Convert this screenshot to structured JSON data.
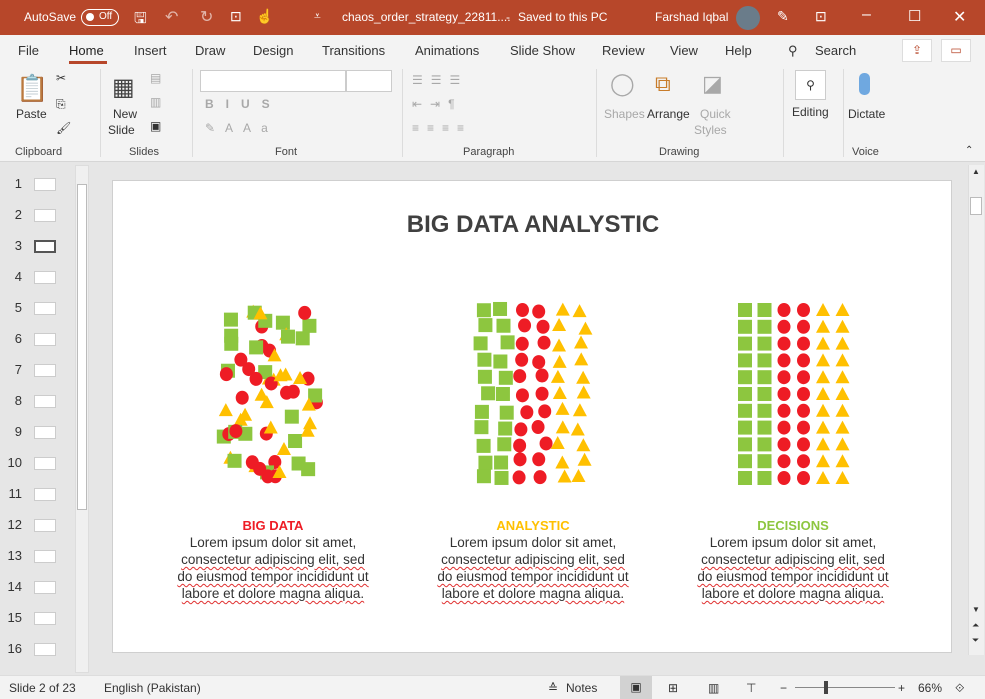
{
  "titlebar": {
    "autosave": "AutoSave",
    "autosave_state": "Off",
    "filename": "chaos_order_strategy_22811....",
    "separator": "-",
    "save_status": "Saved to this PC",
    "user": "Farshad Iqbal"
  },
  "menu": [
    "File",
    "Home",
    "Insert",
    "Draw",
    "Design",
    "Transitions",
    "Animations",
    "Slide Show",
    "Review",
    "View",
    "Help"
  ],
  "search": "Search",
  "ribbon": {
    "paste": "Paste",
    "new_slide_1": "New",
    "new_slide_2": "Slide",
    "shapes": "Shapes",
    "arrange": "Arrange",
    "quick_1": "Quick",
    "quick_2": "Styles",
    "editing": "Editing",
    "dictate": "Dictate",
    "groups": [
      "Clipboard",
      "Slides",
      "Font",
      "Paragraph",
      "Drawing",
      "Voice"
    ]
  },
  "thumbnails": [
    "1",
    "2",
    "3",
    "4",
    "5",
    "6",
    "7",
    "8",
    "9",
    "10",
    "11",
    "12",
    "13",
    "14",
    "15",
    "16"
  ],
  "slide": {
    "title": "BIG DATA ANALYSTIC",
    "columns": [
      {
        "heading": "BIG DATA",
        "color": "#ee1c25",
        "lines": [
          "Lorem ipsum dolor sit amet,",
          "consectetur adipiscing elit, sed",
          "do eiusmod tempor incididunt ut",
          "labore et dolore magna aliqua."
        ]
      },
      {
        "heading": "ANALYSTIC",
        "color": "#ffc000",
        "lines": [
          "Lorem ipsum dolor sit amet,",
          "consectetur adipiscing elit, sed",
          "do eiusmod tempor incididunt ut",
          "labore et dolore magna aliqua."
        ]
      },
      {
        "heading": "DECISIONS",
        "color": "#8dc63f",
        "lines": [
          "Lorem ipsum dolor sit amet,",
          "consectetur adipiscing elit, sed",
          "do eiusmod tempor incididunt ut",
          "labore et dolore magna aliqua."
        ]
      }
    ]
  },
  "colors": {
    "square": "#8dc63f",
    "circle": "#ee1c25",
    "triangle": "#ffc000",
    "brand": "#b7472a"
  },
  "status": {
    "slide": "Slide 2 of 23",
    "language": "English (Pakistan)",
    "notes": "Notes",
    "zoom": "66%",
    "zoom_percent": 66
  }
}
